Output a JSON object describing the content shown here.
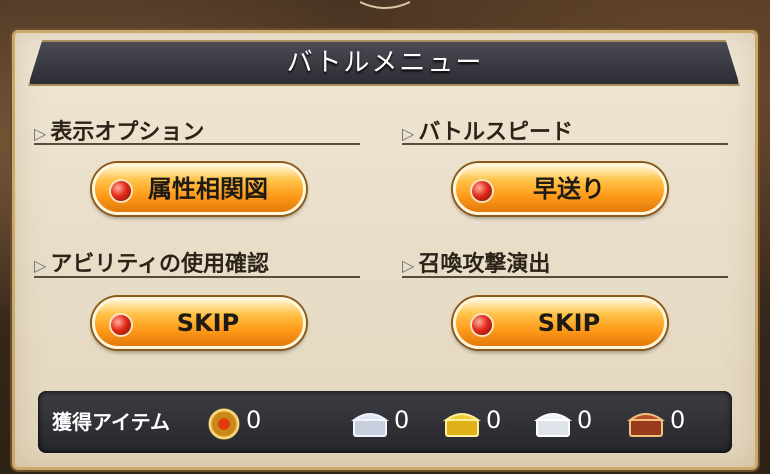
{
  "menu": {
    "title": "バトルメニュー"
  },
  "sections": {
    "display_option": {
      "label": "表示オプション",
      "button": "属性相関図"
    },
    "battle_speed": {
      "label": "バトルスピード",
      "button": "早送り"
    },
    "ability_confirm": {
      "label": "アビリティの使用確認",
      "button": "SKIP"
    },
    "summon_effect": {
      "label": "召喚攻撃演出",
      "button": "SKIP"
    }
  },
  "items": {
    "title": "獲得アイテム",
    "list": [
      {
        "icon": "gold-medal-icon",
        "count": "0"
      },
      {
        "icon": "silver-chest-icon",
        "count": "0"
      },
      {
        "icon": "gold-chest-icon",
        "count": "0"
      },
      {
        "icon": "white-chest-icon",
        "count": "0"
      },
      {
        "icon": "red-chest-icon",
        "count": "0"
      }
    ]
  }
}
